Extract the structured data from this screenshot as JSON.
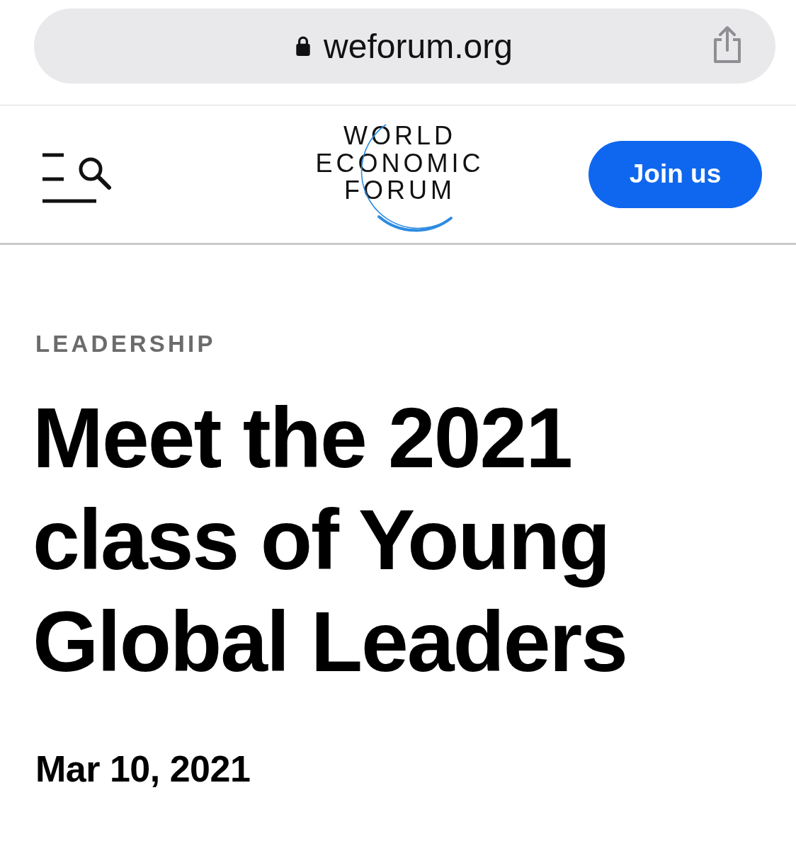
{
  "address_bar": {
    "secure": true,
    "url": "weforum.org"
  },
  "header": {
    "logo_lines": [
      "WORLD",
      "ECONOMIC",
      "FORUM"
    ],
    "join_button": "Join us"
  },
  "article": {
    "category": "LEADERSHIP",
    "title_lines": [
      "Meet the 2021",
      "class of Young",
      "Global Leaders"
    ],
    "date": "Mar 10, 2021"
  }
}
